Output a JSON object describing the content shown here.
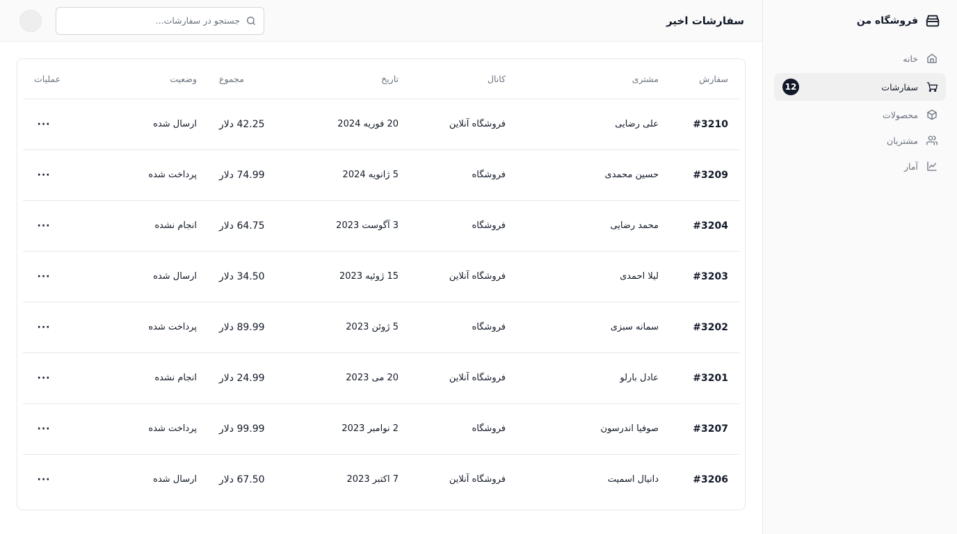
{
  "brand": {
    "name": "فروشگاه من"
  },
  "nav": {
    "items": [
      {
        "label": "خانه",
        "icon": "home-icon"
      },
      {
        "label": "سفارشات",
        "icon": "cart-icon",
        "badge": "12",
        "active": true
      },
      {
        "label": "محصولات",
        "icon": "package-icon"
      },
      {
        "label": "مشتریان",
        "icon": "users-icon"
      },
      {
        "label": "آمار",
        "icon": "chart-icon"
      }
    ]
  },
  "header": {
    "title": "سفارشات اخیر",
    "search_placeholder": "جستجو در سفارشات..."
  },
  "table": {
    "columns": {
      "order": "سفارش",
      "customer": "مشتری",
      "channel": "کانال",
      "date": "تاریخ",
      "total": "مجموع",
      "status": "وضعیت",
      "actions": "عملیات"
    },
    "rows": [
      {
        "order": "#3210",
        "customer": "علی رضایی",
        "channel": "فروشگاه آنلاین",
        "date": "20 فوریه 2024",
        "total": "42.25 دلار",
        "status": "ارسال شده",
        "actions": "···"
      },
      {
        "order": "#3209",
        "customer": "حسین محمدی",
        "channel": "فروشگاه",
        "date": "5 ژانویه 2024",
        "total": "74.99 دلار",
        "status": "پرداخت شده",
        "actions": "···"
      },
      {
        "order": "#3204",
        "customer": "محمد رضایی",
        "channel": "فروشگاه",
        "date": "3 آگوست 2023",
        "total": "64.75 دلار",
        "status": "انجام نشده",
        "actions": "···"
      },
      {
        "order": "#3203",
        "customer": "لیلا احمدی",
        "channel": "فروشگاه آنلاین",
        "date": "15 ژوئیه 2023",
        "total": "34.50 دلار",
        "status": "ارسال شده",
        "actions": "···"
      },
      {
        "order": "#3202",
        "customer": "سمانه سبزی",
        "channel": "فروشگاه",
        "date": "5 ژوئن 2023",
        "total": "89.99 دلار",
        "status": "پرداخت شده",
        "actions": "···"
      },
      {
        "order": "#3201",
        "customer": "عادل بارلو",
        "channel": "فروشگاه آنلاین",
        "date": "20 می 2023",
        "total": "24.99 دلار",
        "status": "انجام نشده",
        "actions": "···"
      },
      {
        "order": "#3207",
        "customer": "صوفیا اندرسون",
        "channel": "فروشگاه",
        "date": "2 نوامبر 2023",
        "total": "99.99 دلار",
        "status": "پرداخت شده",
        "actions": "···"
      },
      {
        "order": "#3206",
        "customer": "دانیال اسمیت",
        "channel": "فروشگاه آنلاین",
        "date": "7 اکتبر 2023",
        "total": "67.50 دلار",
        "status": "ارسال شده",
        "actions": "···"
      }
    ]
  },
  "colors": {
    "sidebar_bg": "#fafafa",
    "active_bg": "#f0f0f0",
    "badge_bg": "#111827",
    "border": "#e5e7eb",
    "muted_text": "#6b7280"
  }
}
